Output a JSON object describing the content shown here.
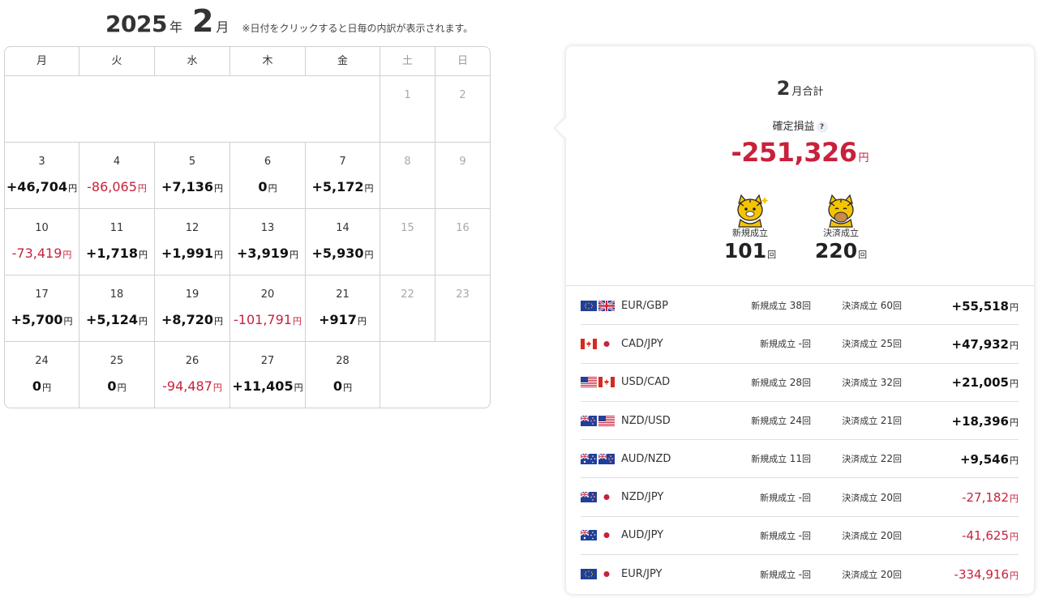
{
  "header": {
    "year": "2025",
    "year_unit": "年",
    "month": "2",
    "month_unit": "月",
    "note": "※日付をクリックすると日毎の内訳が表示されます。"
  },
  "calendar": {
    "weekdays": [
      "月",
      "火",
      "水",
      "木",
      "金",
      "土",
      "日"
    ],
    "yen": "円",
    "week1": {
      "sat": {
        "day": "1"
      },
      "sun": {
        "day": "2"
      }
    },
    "week2": [
      {
        "day": "3",
        "amount": "+46,704"
      },
      {
        "day": "4",
        "amount": "-86,065"
      },
      {
        "day": "5",
        "amount": "+7,136"
      },
      {
        "day": "6",
        "amount": "0"
      },
      {
        "day": "7",
        "amount": "+5,172"
      },
      {
        "day": "8"
      },
      {
        "day": "9"
      }
    ],
    "week3": [
      {
        "day": "10",
        "amount": "-73,419"
      },
      {
        "day": "11",
        "amount": "+1,718"
      },
      {
        "day": "12",
        "amount": "+1,991"
      },
      {
        "day": "13",
        "amount": "+3,919"
      },
      {
        "day": "14",
        "amount": "+5,930"
      },
      {
        "day": "15"
      },
      {
        "day": "16"
      }
    ],
    "week4": [
      {
        "day": "17",
        "amount": "+5,700"
      },
      {
        "day": "18",
        "amount": "+5,124"
      },
      {
        "day": "19",
        "amount": "+8,720"
      },
      {
        "day": "20",
        "amount": "-101,791"
      },
      {
        "day": "21",
        "amount": "+917"
      },
      {
        "day": "22"
      },
      {
        "day": "23"
      }
    ],
    "week5": [
      {
        "day": "24",
        "amount": "0"
      },
      {
        "day": "25",
        "amount": "0"
      },
      {
        "day": "26",
        "amount": "-94,487"
      },
      {
        "day": "27",
        "amount": "+11,405"
      },
      {
        "day": "28",
        "amount": "0"
      }
    ]
  },
  "summary": {
    "month": "2",
    "title_suffix": "月合計",
    "pl_label": "確定損益",
    "help_icon": "?",
    "pl_value": "-251,326",
    "yen": "円",
    "open_label": "新規成立",
    "open_count": "101",
    "close_label": "決済成立",
    "close_count": "220",
    "count_unit": "回",
    "colors": {
      "positive": "#111111",
      "negative": "#c8213c",
      "mascot": "#f5c400"
    },
    "pairs": [
      {
        "pair": "EUR/GBP",
        "flags": [
          "eu-flag-icon",
          "uk-flag-icon"
        ],
        "open": "38",
        "close": "60",
        "pl": "+55,518"
      },
      {
        "pair": "CAD/JPY",
        "flags": [
          "canada-flag-icon",
          "japan-flag-icon"
        ],
        "open": "-",
        "close": "25",
        "pl": "+47,932"
      },
      {
        "pair": "USD/CAD",
        "flags": [
          "us-flag-icon",
          "canada-flag-icon"
        ],
        "open": "28",
        "close": "32",
        "pl": "+21,005"
      },
      {
        "pair": "NZD/USD",
        "flags": [
          "nz-flag-icon",
          "us-flag-icon"
        ],
        "open": "24",
        "close": "21",
        "pl": "+18,396"
      },
      {
        "pair": "AUD/NZD",
        "flags": [
          "australia-flag-icon",
          "nz-flag-icon"
        ],
        "open": "11",
        "close": "22",
        "pl": "+9,546"
      },
      {
        "pair": "NZD/JPY",
        "flags": [
          "nz-flag-icon",
          "japan-flag-icon"
        ],
        "open": "-",
        "close": "20",
        "pl": "-27,182"
      },
      {
        "pair": "AUD/JPY",
        "flags": [
          "australia-flag-icon",
          "japan-flag-icon"
        ],
        "open": "-",
        "close": "20",
        "pl": "-41,625"
      },
      {
        "pair": "EUR/JPY",
        "flags": [
          "eu-flag-icon",
          "japan-flag-icon"
        ],
        "open": "-",
        "close": "20",
        "pl": "-334,916"
      }
    ]
  }
}
